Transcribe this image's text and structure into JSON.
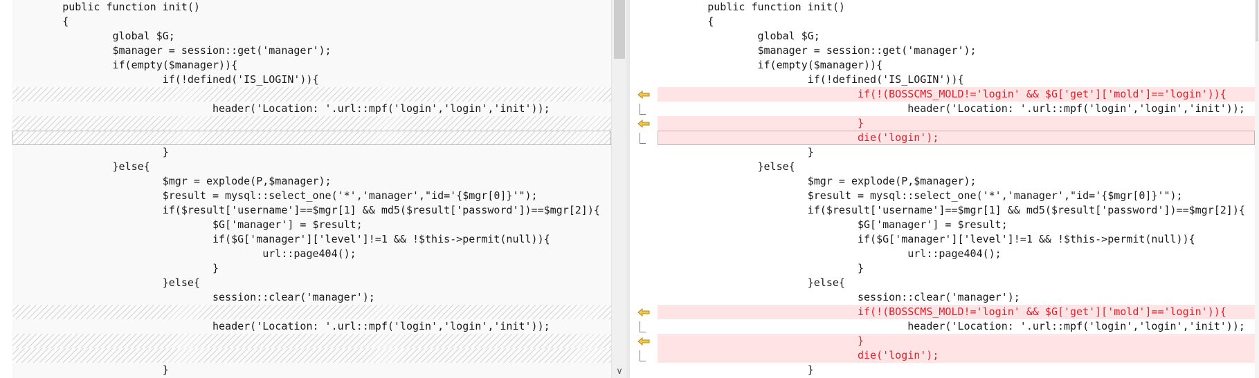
{
  "left_pane": {
    "lines": [
      {
        "text": "        public function init()",
        "kind": "normal"
      },
      {
        "text": "        {",
        "kind": "normal"
      },
      {
        "text": "                global $G;",
        "kind": "normal"
      },
      {
        "text": "                $manager = session::get('manager');",
        "kind": "normal"
      },
      {
        "text": "                if(empty($manager)){",
        "kind": "normal"
      },
      {
        "text": "                        if(!defined('IS_LOGIN')){",
        "kind": "normal"
      },
      {
        "text": "",
        "kind": "placeholder"
      },
      {
        "text": "                                header('Location: '.url::mpf('login','login','init'));",
        "kind": "normal"
      },
      {
        "text": "",
        "kind": "placeholder"
      },
      {
        "text": "",
        "kind": "placeholder-boxed"
      },
      {
        "text": "                        }",
        "kind": "normal"
      },
      {
        "text": "                }else{",
        "kind": "normal"
      },
      {
        "text": "                        $mgr = explode(P,$manager);",
        "kind": "normal"
      },
      {
        "text": "                        $result = mysql::select_one('*','manager',\"id='{$mgr[0]}'\");",
        "kind": "normal"
      },
      {
        "text": "                        if($result['username']==$mgr[1] && md5($result['password'])==$mgr[2]){",
        "kind": "normal"
      },
      {
        "text": "                                $G['manager'] = $result;",
        "kind": "normal"
      },
      {
        "text": "                                if($G['manager']['level']!=1 && !$this->permit(null)){",
        "kind": "normal"
      },
      {
        "text": "                                        url::page404();",
        "kind": "normal"
      },
      {
        "text": "                                }",
        "kind": "normal"
      },
      {
        "text": "                        }else{",
        "kind": "normal"
      },
      {
        "text": "                                session::clear('manager');",
        "kind": "normal"
      },
      {
        "text": "",
        "kind": "placeholder"
      },
      {
        "text": "                                header('Location: '.url::mpf('login','login','init'));",
        "kind": "normal"
      },
      {
        "text": "",
        "kind": "placeholder"
      },
      {
        "text": "",
        "kind": "placeholder"
      },
      {
        "text": "                        }",
        "kind": "normal"
      }
    ]
  },
  "right_pane": {
    "lines": [
      {
        "text": "        public function init()",
        "kind": "normal"
      },
      {
        "text": "        {",
        "kind": "normal"
      },
      {
        "text": "                global $G;",
        "kind": "normal"
      },
      {
        "text": "                $manager = session::get('manager');",
        "kind": "normal"
      },
      {
        "text": "                if(empty($manager)){",
        "kind": "normal"
      },
      {
        "text": "                        if(!defined('IS_LOGIN')){",
        "kind": "normal"
      },
      {
        "text": "                                if(!(BOSSCMS_MOLD!='login' && $G['get']['mold']=='login')){",
        "kind": "changed"
      },
      {
        "text": "                                        header('Location: '.url::mpf('login','login','init'));",
        "kind": "normal"
      },
      {
        "text": "                                }",
        "kind": "changed"
      },
      {
        "text": "                                die('login');",
        "kind": "changed-boxed"
      },
      {
        "text": "                        }",
        "kind": "normal"
      },
      {
        "text": "                }else{",
        "kind": "normal"
      },
      {
        "text": "                        $mgr = explode(P,$manager);",
        "kind": "normal"
      },
      {
        "text": "                        $result = mysql::select_one('*','manager',\"id='{$mgr[0]}'\");",
        "kind": "normal"
      },
      {
        "text": "                        if($result['username']==$mgr[1] && md5($result['password'])==$mgr[2]){",
        "kind": "normal"
      },
      {
        "text": "                                $G['manager'] = $result;",
        "kind": "normal"
      },
      {
        "text": "                                if($G['manager']['level']!=1 && !$this->permit(null)){",
        "kind": "normal"
      },
      {
        "text": "                                        url::page404();",
        "kind": "normal"
      },
      {
        "text": "                                }",
        "kind": "normal"
      },
      {
        "text": "                        }else{",
        "kind": "normal"
      },
      {
        "text": "                                session::clear('manager');",
        "kind": "normal"
      },
      {
        "text": "                                if(!(BOSSCMS_MOLD!='login' && $G['get']['mold']=='login')){",
        "kind": "changed"
      },
      {
        "text": "                                        header('Location: '.url::mpf('login','login','init'));",
        "kind": "normal"
      },
      {
        "text": "                                }",
        "kind": "changed"
      },
      {
        "text": "                                die('login');",
        "kind": "changed"
      },
      {
        "text": "                        }",
        "kind": "normal"
      }
    ]
  },
  "diff_markers": [
    {
      "row": 6,
      "icon": "copy-left-arrow-icon"
    },
    {
      "row": 8,
      "icon": "copy-left-arrow-icon"
    },
    {
      "row": 21,
      "icon": "copy-left-arrow-icon"
    },
    {
      "row": 23,
      "icon": "copy-left-arrow-icon"
    }
  ],
  "colors": {
    "changed_text": "#e0202a",
    "changed_background": "#ffe4e6",
    "marker_arrow": "#f2c94c"
  },
  "scroll": {
    "down_arrow_glyph": "∨"
  }
}
